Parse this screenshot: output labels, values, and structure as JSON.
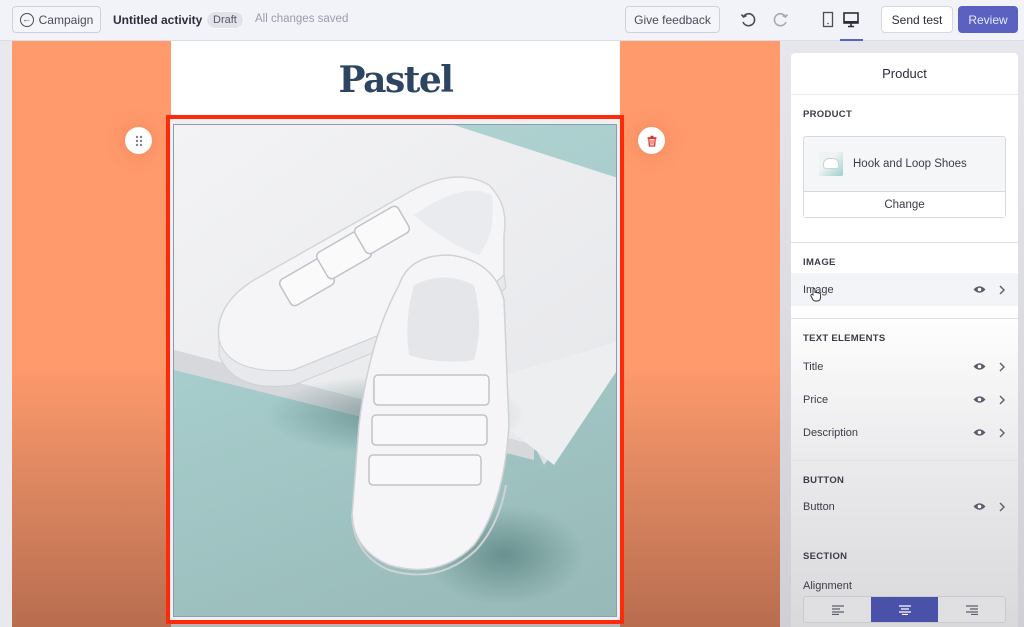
{
  "topbar": {
    "back_label": "Campaign",
    "activity_title": "Untitled activity",
    "status_badge": "Draft",
    "save_status": "All changes saved",
    "feedback_label": "Give feedback",
    "send_test_label": "Send test",
    "review_label": "Review",
    "active_view": "desktop",
    "colors": {
      "primary": "#5b61c0"
    }
  },
  "email": {
    "logo_text": "Pastel",
    "selected_block": "product-image",
    "selection_color": "#ff2a0a",
    "background_color": "#ff9a6c",
    "image_description": "White hook-and-loop sneakers on a white block against a mint background"
  },
  "panel": {
    "title": "Product",
    "product_section": {
      "label": "PRODUCT",
      "product_name": "Hook and Loop Shoes",
      "change_label": "Change"
    },
    "image_section": {
      "label": "IMAGE",
      "items": [
        {
          "label": "Image",
          "visible": true
        }
      ]
    },
    "text_section": {
      "label": "TEXT ELEMENTS",
      "items": [
        {
          "label": "Title",
          "visible": true
        },
        {
          "label": "Price",
          "visible": true
        },
        {
          "label": "Description",
          "visible": true
        }
      ]
    },
    "button_section": {
      "label": "BUTTON",
      "items": [
        {
          "label": "Button",
          "visible": true
        }
      ]
    },
    "section_section": {
      "label": "SECTION",
      "alignment_label": "Alignment",
      "alignment_options": [
        "left",
        "center",
        "right"
      ],
      "alignment_selected": "center"
    }
  }
}
